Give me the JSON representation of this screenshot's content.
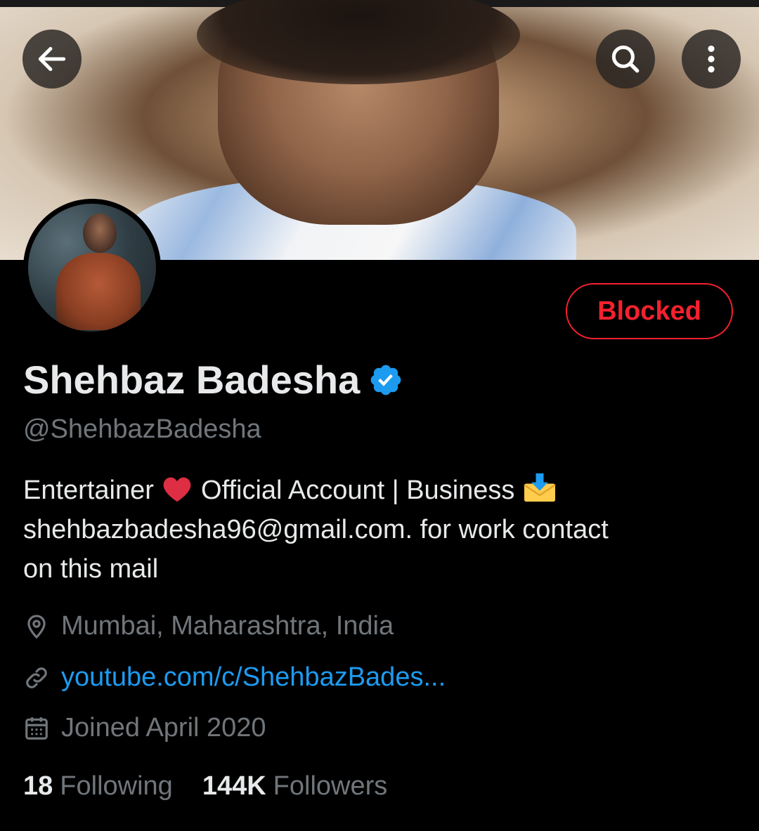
{
  "header": {
    "back_icon": "arrow-left-icon",
    "search_icon": "search-icon",
    "more_icon": "more-vertical-icon"
  },
  "profile": {
    "display_name": "Shehbaz Badesha",
    "verified": true,
    "handle": "@ShehbazBadesha",
    "action_button_label": "Blocked",
    "bio_line1_part1": "Entertainer",
    "bio_line1_part2": "Official Account | Business",
    "bio_line2": "shehbazbadesha96@gmail.com.  for work contact",
    "bio_line3": "on this mail",
    "location": "Mumbai, Maharashtra, India",
    "website": "youtube.com/c/ShehbazBades...",
    "joined": "Joined April 2020",
    "following_count": "18",
    "following_label": "Following",
    "followers_count": "144K",
    "followers_label": "Followers"
  },
  "colors": {
    "background": "#000000",
    "primary_text": "#e7e9ea",
    "secondary_text": "#71767b",
    "link": "#1d9bf0",
    "blocked_red": "#f4212e",
    "verified_blue": "#1d9bf0"
  }
}
